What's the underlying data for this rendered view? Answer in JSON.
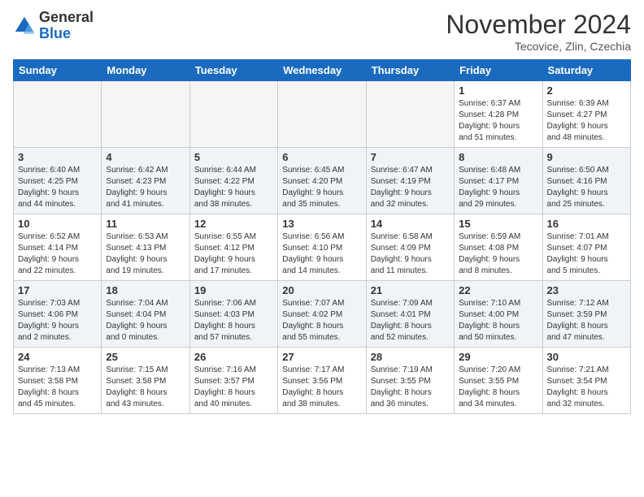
{
  "logo": {
    "general": "General",
    "blue": "Blue"
  },
  "title": "November 2024",
  "location": "Tecovice, Zlin, Czechia",
  "days_of_week": [
    "Sunday",
    "Monday",
    "Tuesday",
    "Wednesday",
    "Thursday",
    "Friday",
    "Saturday"
  ],
  "weeks": [
    [
      {
        "day": "",
        "info": ""
      },
      {
        "day": "",
        "info": ""
      },
      {
        "day": "",
        "info": ""
      },
      {
        "day": "",
        "info": ""
      },
      {
        "day": "",
        "info": ""
      },
      {
        "day": "1",
        "info": "Sunrise: 6:37 AM\nSunset: 4:28 PM\nDaylight: 9 hours\nand 51 minutes."
      },
      {
        "day": "2",
        "info": "Sunrise: 6:39 AM\nSunset: 4:27 PM\nDaylight: 9 hours\nand 48 minutes."
      }
    ],
    [
      {
        "day": "3",
        "info": "Sunrise: 6:40 AM\nSunset: 4:25 PM\nDaylight: 9 hours\nand 44 minutes."
      },
      {
        "day": "4",
        "info": "Sunrise: 6:42 AM\nSunset: 4:23 PM\nDaylight: 9 hours\nand 41 minutes."
      },
      {
        "day": "5",
        "info": "Sunrise: 6:44 AM\nSunset: 4:22 PM\nDaylight: 9 hours\nand 38 minutes."
      },
      {
        "day": "6",
        "info": "Sunrise: 6:45 AM\nSunset: 4:20 PM\nDaylight: 9 hours\nand 35 minutes."
      },
      {
        "day": "7",
        "info": "Sunrise: 6:47 AM\nSunset: 4:19 PM\nDaylight: 9 hours\nand 32 minutes."
      },
      {
        "day": "8",
        "info": "Sunrise: 6:48 AM\nSunset: 4:17 PM\nDaylight: 9 hours\nand 29 minutes."
      },
      {
        "day": "9",
        "info": "Sunrise: 6:50 AM\nSunset: 4:16 PM\nDaylight: 9 hours\nand 25 minutes."
      }
    ],
    [
      {
        "day": "10",
        "info": "Sunrise: 6:52 AM\nSunset: 4:14 PM\nDaylight: 9 hours\nand 22 minutes."
      },
      {
        "day": "11",
        "info": "Sunrise: 6:53 AM\nSunset: 4:13 PM\nDaylight: 9 hours\nand 19 minutes."
      },
      {
        "day": "12",
        "info": "Sunrise: 6:55 AM\nSunset: 4:12 PM\nDaylight: 9 hours\nand 17 minutes."
      },
      {
        "day": "13",
        "info": "Sunrise: 6:56 AM\nSunset: 4:10 PM\nDaylight: 9 hours\nand 14 minutes."
      },
      {
        "day": "14",
        "info": "Sunrise: 6:58 AM\nSunset: 4:09 PM\nDaylight: 9 hours\nand 11 minutes."
      },
      {
        "day": "15",
        "info": "Sunrise: 6:59 AM\nSunset: 4:08 PM\nDaylight: 9 hours\nand 8 minutes."
      },
      {
        "day": "16",
        "info": "Sunrise: 7:01 AM\nSunset: 4:07 PM\nDaylight: 9 hours\nand 5 minutes."
      }
    ],
    [
      {
        "day": "17",
        "info": "Sunrise: 7:03 AM\nSunset: 4:06 PM\nDaylight: 9 hours\nand 2 minutes."
      },
      {
        "day": "18",
        "info": "Sunrise: 7:04 AM\nSunset: 4:04 PM\nDaylight: 9 hours\nand 0 minutes."
      },
      {
        "day": "19",
        "info": "Sunrise: 7:06 AM\nSunset: 4:03 PM\nDaylight: 8 hours\nand 57 minutes."
      },
      {
        "day": "20",
        "info": "Sunrise: 7:07 AM\nSunset: 4:02 PM\nDaylight: 8 hours\nand 55 minutes."
      },
      {
        "day": "21",
        "info": "Sunrise: 7:09 AM\nSunset: 4:01 PM\nDaylight: 8 hours\nand 52 minutes."
      },
      {
        "day": "22",
        "info": "Sunrise: 7:10 AM\nSunset: 4:00 PM\nDaylight: 8 hours\nand 50 minutes."
      },
      {
        "day": "23",
        "info": "Sunrise: 7:12 AM\nSunset: 3:59 PM\nDaylight: 8 hours\nand 47 minutes."
      }
    ],
    [
      {
        "day": "24",
        "info": "Sunrise: 7:13 AM\nSunset: 3:58 PM\nDaylight: 8 hours\nand 45 minutes."
      },
      {
        "day": "25",
        "info": "Sunrise: 7:15 AM\nSunset: 3:58 PM\nDaylight: 8 hours\nand 43 minutes."
      },
      {
        "day": "26",
        "info": "Sunrise: 7:16 AM\nSunset: 3:57 PM\nDaylight: 8 hours\nand 40 minutes."
      },
      {
        "day": "27",
        "info": "Sunrise: 7:17 AM\nSunset: 3:56 PM\nDaylight: 8 hours\nand 38 minutes."
      },
      {
        "day": "28",
        "info": "Sunrise: 7:19 AM\nSunset: 3:55 PM\nDaylight: 8 hours\nand 36 minutes."
      },
      {
        "day": "29",
        "info": "Sunrise: 7:20 AM\nSunset: 3:55 PM\nDaylight: 8 hours\nand 34 minutes."
      },
      {
        "day": "30",
        "info": "Sunrise: 7:21 AM\nSunset: 3:54 PM\nDaylight: 8 hours\nand 32 minutes."
      }
    ]
  ]
}
